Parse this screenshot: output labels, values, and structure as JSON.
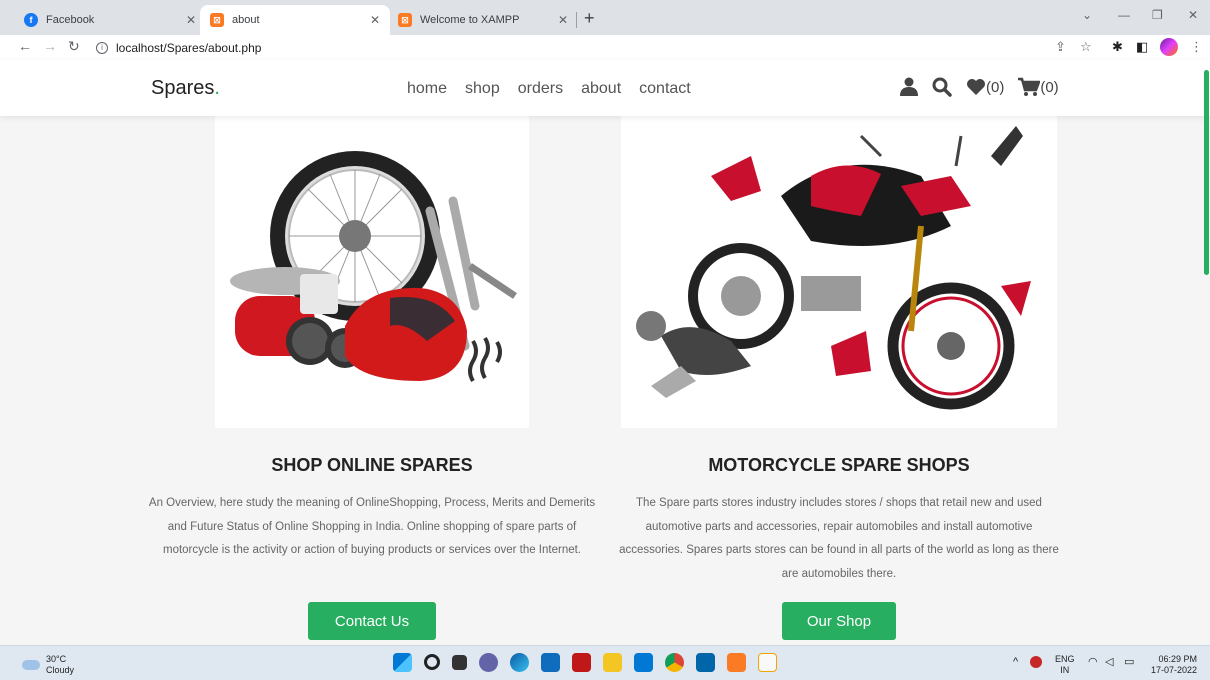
{
  "browser": {
    "tabs": [
      {
        "title": "Facebook",
        "favicon": "facebook-icon",
        "active": false
      },
      {
        "title": "about",
        "favicon": "xampp-icon",
        "active": true
      },
      {
        "title": "Welcome to XAMPP",
        "favicon": "xampp-icon",
        "active": false
      }
    ],
    "url": "localhost/Spares/about.php"
  },
  "site": {
    "logo": "Spares",
    "logo_dot": ".",
    "nav": [
      "home",
      "shop",
      "orders",
      "about",
      "contact"
    ],
    "wishlist_count": "(0)",
    "cart_count": "(0)",
    "accent": "#27ae60"
  },
  "sections": [
    {
      "title": "SHOP ONLINE SPARES",
      "text": "An Overview, here study the meaning of OnlineShopping, Process, Merits and Demerits and Future Status of Online Shopping in India. Online shopping of spare parts of motorcycle is the activity or action of buying products or services over the Internet.",
      "button": "Contact Us"
    },
    {
      "title": "MOTORCYCLE SPARE SHOPS",
      "text": "The Spare parts stores industry includes stores / shops that retail new and used automotive parts and accessories, repair automobiles and install automotive accessories. Spares parts stores can be found in all parts of the world as long as there are automobiles there.",
      "button": "Our Shop"
    }
  ],
  "taskbar": {
    "temp": "30°C",
    "weather": "Cloudy",
    "lang1": "ENG",
    "lang2": "IN",
    "time": "06:29 PM",
    "date": "17-07-2022"
  }
}
